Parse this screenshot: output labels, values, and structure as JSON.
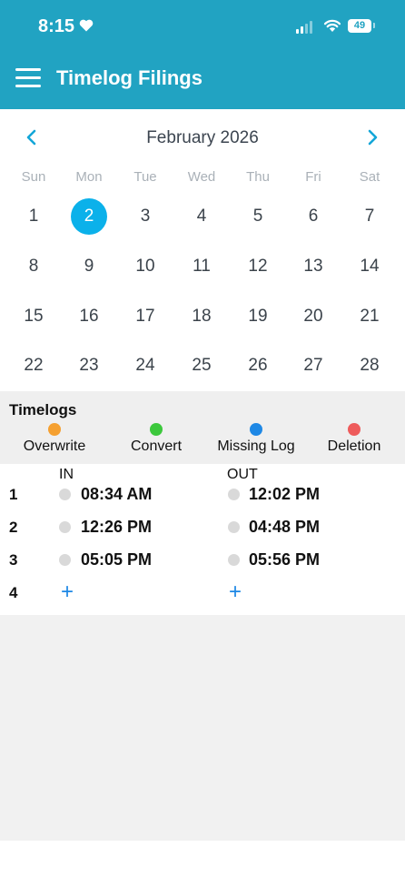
{
  "status_bar": {
    "time": "8:15",
    "battery": "49"
  },
  "header": {
    "title": "Timelog Filings"
  },
  "calendar": {
    "month": "February 2026",
    "weekdays": [
      "Sun",
      "Mon",
      "Tue",
      "Wed",
      "Thu",
      "Fri",
      "Sat"
    ],
    "weeks": [
      [
        "1",
        "2",
        "3",
        "4",
        "5",
        "6",
        "7"
      ],
      [
        "8",
        "9",
        "10",
        "11",
        "12",
        "13",
        "14"
      ],
      [
        "15",
        "16",
        "17",
        "18",
        "19",
        "20",
        "21"
      ],
      [
        "22",
        "23",
        "24",
        "25",
        "26",
        "27",
        "28"
      ]
    ],
    "selected_day": "2"
  },
  "legend": {
    "title": "Timelogs",
    "items": [
      {
        "label": "Overwrite",
        "color": "#f5a030"
      },
      {
        "label": "Convert",
        "color": "#3cc83c"
      },
      {
        "label": "Missing Log",
        "color": "#1e88e5"
      },
      {
        "label": "Deletion",
        "color": "#ee5b5b"
      }
    ]
  },
  "timelogs": {
    "in_label": "IN",
    "out_label": "OUT",
    "rows": [
      {
        "num": "1",
        "in": "08:34 AM",
        "out": "12:02 PM"
      },
      {
        "num": "2",
        "in": "12:26 PM",
        "out": "04:48 PM"
      },
      {
        "num": "3",
        "in": "05:05 PM",
        "out": "05:56 PM"
      },
      {
        "num": "4",
        "in_add": "+",
        "out_add": "+"
      }
    ]
  }
}
